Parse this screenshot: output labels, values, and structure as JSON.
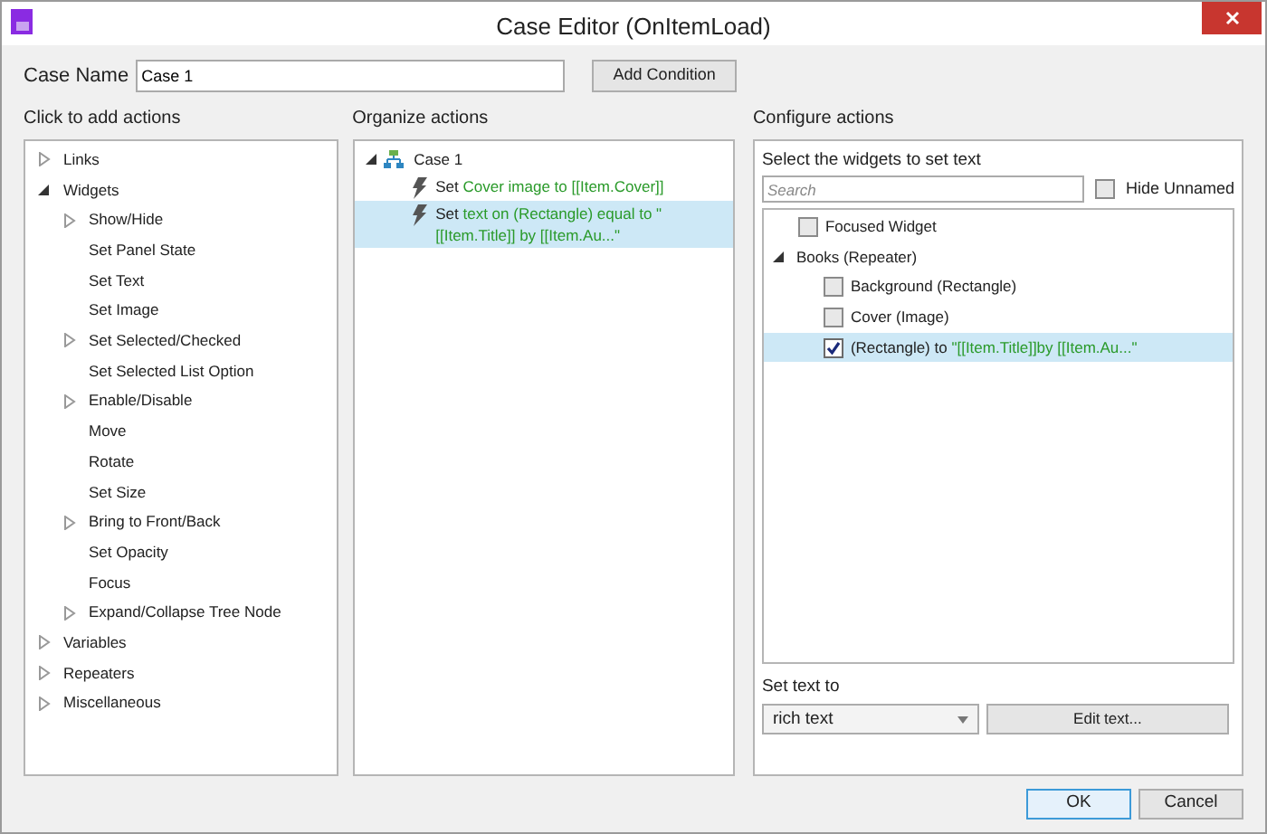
{
  "window": {
    "title": "Case Editor (OnItemLoad)"
  },
  "case_name": {
    "label": "Case Name",
    "value": "Case 1"
  },
  "add_condition_button": "Add Condition",
  "add_actions": {
    "heading": "Click to add actions",
    "items": [
      {
        "kind": "branch",
        "label": "Links",
        "expanded": false
      },
      {
        "kind": "branch",
        "label": "Widgets",
        "expanded": true,
        "children": [
          {
            "kind": "branch",
            "label": "Show/Hide",
            "expanded": false
          },
          {
            "kind": "leaf",
            "label": "Set Panel State"
          },
          {
            "kind": "leaf",
            "label": "Set Text"
          },
          {
            "kind": "leaf",
            "label": "Set Image"
          },
          {
            "kind": "branch",
            "label": "Set Selected/Checked",
            "expanded": false
          },
          {
            "kind": "leaf",
            "label": "Set Selected List Option"
          },
          {
            "kind": "branch",
            "label": "Enable/Disable",
            "expanded": false
          },
          {
            "kind": "leaf",
            "label": "Move"
          },
          {
            "kind": "leaf",
            "label": "Rotate"
          },
          {
            "kind": "leaf",
            "label": "Set Size"
          },
          {
            "kind": "branch",
            "label": "Bring to Front/Back",
            "expanded": false
          },
          {
            "kind": "leaf",
            "label": "Set Opacity"
          },
          {
            "kind": "leaf",
            "label": "Focus"
          },
          {
            "kind": "branch",
            "label": "Expand/Collapse Tree Node",
            "expanded": false
          }
        ]
      },
      {
        "kind": "branch",
        "label": "Variables",
        "expanded": false
      },
      {
        "kind": "branch",
        "label": "Repeaters",
        "expanded": false
      },
      {
        "kind": "branch",
        "label": "Miscellaneous",
        "expanded": false
      }
    ]
  },
  "organize_actions": {
    "heading": "Organize actions",
    "case": {
      "label": "Case 1",
      "expanded": true
    },
    "actions": [
      {
        "verb": "Set",
        "detail": "Cover image to [[Item.Cover]]",
        "selected": false
      },
      {
        "verb": "Set",
        "detail": "text on (Rectangle) equal to \"[[Item.Title]] by [[Item.Au...\"",
        "selected": true
      }
    ]
  },
  "configure_actions": {
    "heading": "Configure actions",
    "subheading": "Select the widgets to set text",
    "search": {
      "placeholder": "Search"
    },
    "hide_unnamed": {
      "label": "Hide Unnamed",
      "checked": false
    },
    "widgets": [
      {
        "kind": "checkbox",
        "label": "Focused Widget",
        "checked": false,
        "selected": false
      },
      {
        "kind": "branch",
        "label": "Books (Repeater)",
        "expanded": true,
        "selected": false,
        "children": [
          {
            "kind": "checkbox",
            "label": "Background (Rectangle)",
            "checked": false,
            "selected": false
          },
          {
            "kind": "checkbox",
            "label": "Cover (Image)",
            "checked": false,
            "selected": false
          },
          {
            "kind": "checkbox",
            "label": "(Rectangle) to ",
            "detail": "\"[[Item.Title]]by [[Item.Au...\"",
            "checked": true,
            "selected": true
          }
        ]
      }
    ],
    "set_text_to": {
      "label": "Set text to",
      "value": "rich text",
      "button": "Edit text..."
    }
  },
  "buttons": [
    {
      "label": "OK",
      "default": true
    },
    {
      "label": "Cancel",
      "default": false
    }
  ]
}
